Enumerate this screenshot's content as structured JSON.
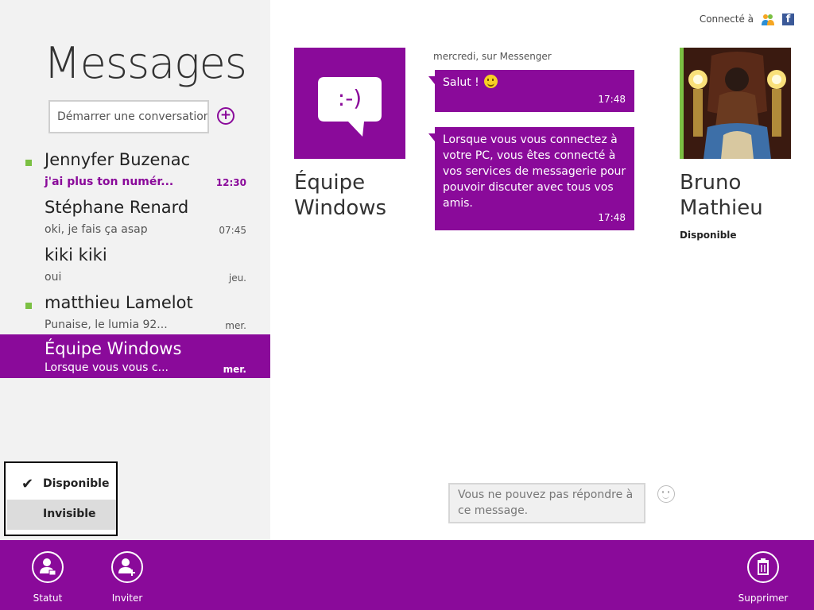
{
  "sidebar": {
    "title": "Messages",
    "search_placeholder": "Démarrer une conversation",
    "add_label": "+",
    "conversations": [
      {
        "name": "Jennyfer Buzenac",
        "preview": "j'ai plus ton numér...",
        "time": "12:30",
        "online": true,
        "unread": true,
        "selected": false
      },
      {
        "name": "Stéphane Renard",
        "preview": "oki, je fais ça asap",
        "time": "07:45",
        "online": false,
        "unread": false,
        "selected": false
      },
      {
        "name": "kiki kiki",
        "preview": "oui",
        "time": "jeu.",
        "online": false,
        "unread": false,
        "selected": false
      },
      {
        "name": "matthieu Lamelot",
        "preview": "Punaise, le lumia 92...",
        "time": "mer.",
        "online": true,
        "unread": false,
        "selected": false
      },
      {
        "name": "Équipe Windows",
        "preview": "Lorsque vous vous c...",
        "time": "mer.",
        "online": false,
        "unread": false,
        "selected": true
      }
    ]
  },
  "status_menu": {
    "options": [
      {
        "label": "Disponible",
        "checked": true
      },
      {
        "label": "Invisible",
        "checked": false
      }
    ]
  },
  "header": {
    "connected_label": "Connecté à",
    "services": [
      "messenger-icon",
      "facebook-icon"
    ],
    "facebook_letter": "f"
  },
  "conversation": {
    "contact_left": {
      "name_line1": "Équipe",
      "name_line2": "Windows",
      "avatar_text": ":-)"
    },
    "contact_right": {
      "name_line1": "Bruno",
      "name_line2": "Mathieu",
      "status": "Disponible"
    },
    "date_label": "mercredi, sur Messenger",
    "messages": [
      {
        "text": "Salut ! ",
        "emoji": "smiley",
        "time": "17:48"
      },
      {
        "text": "Lorsque vous vous connectez à votre PC, vous êtes connecté à vos services de messagerie pour pouvoir discuter avec tous vos amis.",
        "time": "17:48"
      }
    ],
    "reply_placeholder": "Vous ne pouvez pas répondre à ce message."
  },
  "appbar": {
    "statut_label": "Statut",
    "inviter_label": "Inviter",
    "supprimer_label": "Supprimer"
  },
  "colors": {
    "accent": "#8a0a9a",
    "online": "#7bc043",
    "sidebar_bg": "#f2f2f2"
  }
}
